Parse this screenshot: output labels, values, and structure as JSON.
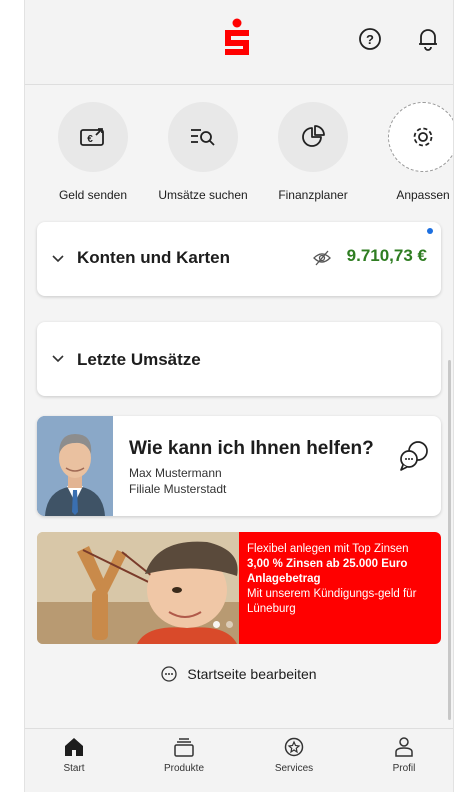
{
  "header": {
    "logo": "sparkasse-logo",
    "icons": [
      "help-icon",
      "bell-icon"
    ]
  },
  "quick_actions": [
    {
      "label": "Geld senden",
      "icon": "money-send-icon"
    },
    {
      "label": "Umsätze suchen",
      "icon": "search-list-icon"
    },
    {
      "label": "Finanzplaner",
      "icon": "pie-chart-icon"
    },
    {
      "label": "Anpassen",
      "icon": "gear-icon"
    }
  ],
  "accounts": {
    "title": "Konten und Karten",
    "balance": "9.710,73 €",
    "balance_color": "#2f7d22"
  },
  "transactions": {
    "title": "Letzte Umsätze"
  },
  "advisor": {
    "title": "Wie kann ich Ihnen helfen?",
    "name": "Max Mustermann",
    "branch": "Filiale Musterstadt"
  },
  "promo": {
    "line1": "Flexibel anlegen mit Top Zinsen",
    "line2": "3,00 % Zinsen ab 25.000 Euro Anlagebetrag",
    "line3": "Mit unserem Kündigungs-geld für Lüneburg",
    "color": "#ff0000"
  },
  "edit_label": "Startseite bearbeiten",
  "tabs": [
    {
      "label": "Start",
      "icon": "home-icon"
    },
    {
      "label": "Produkte",
      "icon": "stack-icon"
    },
    {
      "label": "Services",
      "icon": "services-icon"
    },
    {
      "label": "Profil",
      "icon": "person-icon"
    }
  ]
}
